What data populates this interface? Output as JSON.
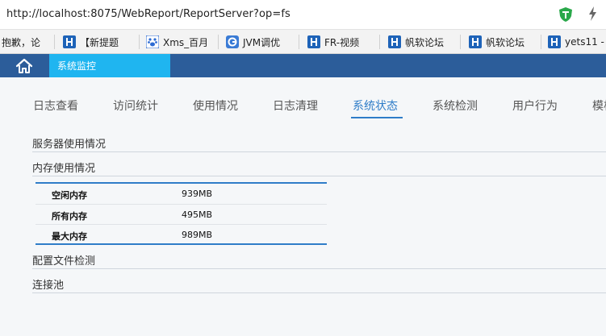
{
  "browser": {
    "url": "http://localhost:8075/WebReport/ReportServer?op=fs",
    "bookmarks": [
      {
        "label": "抱歉，论",
        "icon": "none"
      },
      {
        "label": "【新提题",
        "icon": "fanruan-logo-icon"
      },
      {
        "label": "Xms_百月",
        "icon": "baidu-paw-icon"
      },
      {
        "label": "JVM调优",
        "icon": "g-logo-icon"
      },
      {
        "label": "FR-视频",
        "icon": "fanruan-logo-icon"
      },
      {
        "label": "帆软论坛",
        "icon": "fanruan-logo-icon"
      },
      {
        "label": "帆软论坛",
        "icon": "fanruan-logo-icon"
      },
      {
        "label": "yets11 -",
        "icon": "fanruan-logo-icon"
      }
    ]
  },
  "topnav": {
    "home_icon": "home-icon",
    "active_tab": "系统监控"
  },
  "subtabs": [
    {
      "label": "日志查看"
    },
    {
      "label": "访问统计"
    },
    {
      "label": "使用情况"
    },
    {
      "label": "日志清理"
    },
    {
      "label": "系统状态"
    },
    {
      "label": "系统检测"
    },
    {
      "label": "用户行为"
    },
    {
      "label": "模板"
    }
  ],
  "active_subtab": "系统状态",
  "sections": {
    "server_usage": "服务器使用情况",
    "memory_usage": "内存使用情况",
    "config_check": "配置文件检测",
    "connection_pool": "连接池"
  },
  "memory": [
    {
      "label": "空闲内存",
      "value": "939MB"
    },
    {
      "label": "所有内存",
      "value": "495MB"
    },
    {
      "label": "最大内存",
      "value": "989MB"
    }
  ],
  "colors": {
    "nav_bg": "#2c5d9a",
    "active_tab_bg": "#1fb5f0",
    "accent": "#2f7dc8"
  }
}
